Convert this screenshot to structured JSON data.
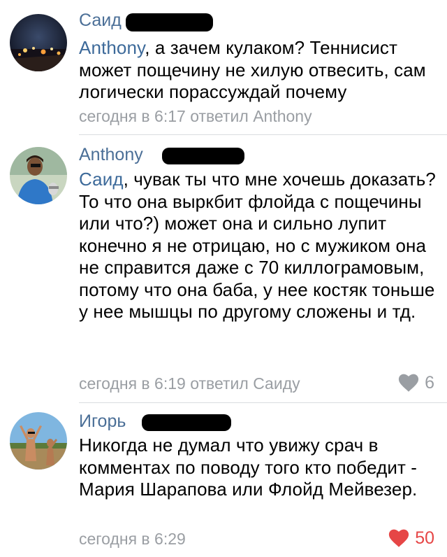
{
  "comments": [
    {
      "author": "Саид",
      "mention": "Anthony",
      "text": ", а зачем кулаком? Теннисист может пощечину не хилую отвесить, сам логически порассуждай почему",
      "meta": "сегодня в 6:17 ответил Anthony",
      "avatar": "night-city-avatar"
    },
    {
      "author": "Anthony",
      "mention": "Саид",
      "text": ", чувак ты что мне хочешь доказать? То что она выркбит флойда с пощечины или что?) может она и сильно лупит конечно я не отрицаю, но с мужиком она не справится даже с 70 киллограмовым, потому что она баба, у нее костяк тоньше у нее мышцы по другому сложены и тд.",
      "meta": "сегодня в 6:19 ответил Саиду",
      "likes": "6",
      "liked": false,
      "avatar": "man-in-blue-avatar"
    },
    {
      "author": "Игорь",
      "mention": "",
      "text": "Никогда не думал что увижу срач в комментах по поводу того кто победит - Мария Шарапова или Флойд Мейвезер.",
      "meta": "сегодня в 6:29",
      "likes": "50",
      "liked": true,
      "avatar": "two-men-avatar"
    }
  ],
  "colors": {
    "name": "#4b6f97",
    "meta": "#9a9ea3",
    "liked_heart": "#e64646",
    "divider": "#d9dcdf"
  }
}
